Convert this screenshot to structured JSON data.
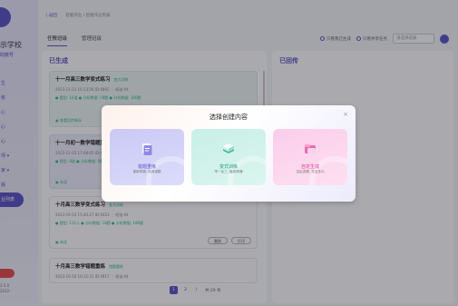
{
  "sidebar": {
    "school_name": "示学校",
    "school_sub": "助教号",
    "items": [
      {
        "label": "生"
      },
      {
        "label": "练"
      },
      {
        "label": "心"
      },
      {
        "label": "心"
      },
      {
        "label": "心"
      },
      {
        "label": "师 ▾"
      },
      {
        "label": "家 ▾"
      },
      {
        "label": "版"
      },
      {
        "label": "业列表"
      }
    ],
    "version_line1": "2.5.0",
    "version_line2": "2022-"
  },
  "header": {
    "back_label": "〈 返回",
    "breadcrumb": "智能作业  /  智能作业列表"
  },
  "tabs": [
    {
      "label": "任教班级"
    },
    {
      "label": "管理班级"
    }
  ],
  "filters": {
    "only_mine": "只看我已生成",
    "only_shared": "只看共享任务",
    "select_placeholder": "请选择班级"
  },
  "columns": {
    "left_title": "已生成",
    "right_title": "已回传"
  },
  "cards": [
    {
      "title": "十一月高三数学变式练习",
      "tag": "变式训练",
      "meta": "2023-11-23 16:13:56    ID:4865 ⋮ 纸张:A4",
      "stats": "● 题型: 16道   ● 分析数据: 18题   ● 分析数据: 180题",
      "footer": "▣ 查看回传情况"
    },
    {
      "title": "十一月初一数学错题重练",
      "tag": "错题重练",
      "meta": "2023-11-03 17:08:05    ID:4865 ⋮ 纸张:A4",
      "stats": "● 题型: 8道   ● 分析数据: 9题   ● 分析数据: 6题",
      "footer": "▣ 未读"
    },
    {
      "title": "十月高三数学变式练习",
      "tag": "变式训练",
      "meta": "2023-10-24 15:40:27    ID:4023 ⋮ 纸张:A4",
      "stats": "● 题型: 111人   ● 分析数据: 18题   ● 分析数据: 186题",
      "footer": "▣ 未读",
      "btn_delete": "删除",
      "btn_print": "打印"
    },
    {
      "title": "十月高三数学错题重练",
      "tag": "错题重练",
      "meta": "2023-10-16 16:12:31    ID:3917 ⋮ 纸张:A4",
      "stats": "",
      "footer": ""
    }
  ],
  "pagination": {
    "pages": [
      "1",
      "2"
    ],
    "next": "〉",
    "total": "共 29 条"
  },
  "modal": {
    "title": "选择创建内容",
    "close": "×",
    "options": [
      {
        "label": "错题重练",
        "desc": "重新练题, 巩固错题",
        "color": "#5b54c6"
      },
      {
        "label": "变式训练",
        "desc": "举一反三, 触类旁通",
        "color": "#1a9b7a"
      },
      {
        "label": "自定生成",
        "desc": "自由选题, 灵活多元",
        "color": "#d83a92"
      }
    ]
  },
  "colors": {
    "accent": "#5b54c6",
    "danger": "#e74c4c",
    "success": "#33bb88"
  }
}
